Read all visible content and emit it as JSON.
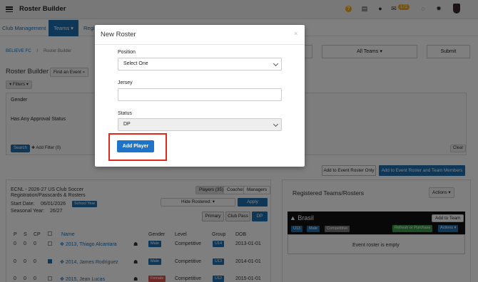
{
  "app": {
    "title": "Roster Builder",
    "notification_count": "172"
  },
  "nav": {
    "club_management": "Club Management",
    "teams": "Teams ▾",
    "registration": "Regi"
  },
  "breadcrumb": {
    "home": "BELIEVE FC",
    "sep": "/",
    "current": "Roster Builder"
  },
  "header_controls": {
    "all_teams": "All Teams ▾",
    "submit": "Submit"
  },
  "page": {
    "title": "Roster Builder",
    "find_event": "Find an Event ",
    "filters": "▾ Filters ▾",
    "gender_label": "Gender",
    "approval_label": "Has Any Approval Status",
    "search": "Search",
    "add_filter": "Add Filter (0)",
    "clear": "Clear"
  },
  "actions": {
    "add_event_roster_only": "Add to Event Roster Only",
    "add_roster_team_members": "Add to Event Roster and Team Members"
  },
  "event": {
    "name_line1": "ECNL - 2026-27 US Club Soccer",
    "name_line2": "Registration/Passcards & Rosters",
    "start_label": "Start Date:",
    "start_value": "06/01/2026",
    "school_year_tag": "School Year",
    "season_label": "Seasonal Year:",
    "season_value": "26/27",
    "tabs": [
      "Players (35)",
      "Coaches",
      "Managers"
    ],
    "hide_rostered": "Hide Rostered: ▾",
    "apply": "Apply",
    "pill_primary": "Primary",
    "pill_club_pass": "Club Pass",
    "pill_dp": "DP",
    "columns": {
      "p": "P",
      "s": "S",
      "cp": "CP",
      "name": "Name",
      "gender": "Gender",
      "level": "Level",
      "group": "Group",
      "dob": "DOB"
    },
    "rows": [
      {
        "p": "0",
        "s": "0",
        "cp": "0",
        "name": "2013, Thiago Alcantara",
        "gender": "Male",
        "level": "Competitive",
        "group": "U14",
        "dob": "2013-01-01"
      },
      {
        "p": "0",
        "s": "0",
        "cp": "0",
        "name": "2014, James Rodriguez",
        "gender": "Male",
        "level": "Competitive",
        "group": "U13",
        "dob": "2014-01-01"
      },
      {
        "p": "0",
        "s": "0",
        "cp": "0",
        "name": "2015, Jean Lucas",
        "gender": "Female",
        "level": "Competitive",
        "group": "U12",
        "dob": "2015-01-01"
      }
    ]
  },
  "registered": {
    "title": "Registered Teams/Rosters",
    "actions": "Actions ▾",
    "team_name": "Brasil",
    "add_to_team": "Add to Team",
    "tags": [
      "U13",
      "Male",
      "Competitive"
    ],
    "refresh": "Refresh or Purchase",
    "team_actions": "Actions ▾",
    "empty": "Event roster is empty"
  },
  "modal": {
    "title": "New Roster",
    "close": "×",
    "position_label": "Position",
    "position_value": "Select One",
    "jersey_label": "Jersey",
    "jersey_value": "",
    "status_label": "Status",
    "status_value": "DP",
    "add_player": "Add Player"
  },
  "colors": {
    "primary": "#1f6fb0",
    "warning": "#f0a81a",
    "highlight": "#e0291d",
    "female_tag": "#d9534f",
    "success": "#3a9b46"
  }
}
